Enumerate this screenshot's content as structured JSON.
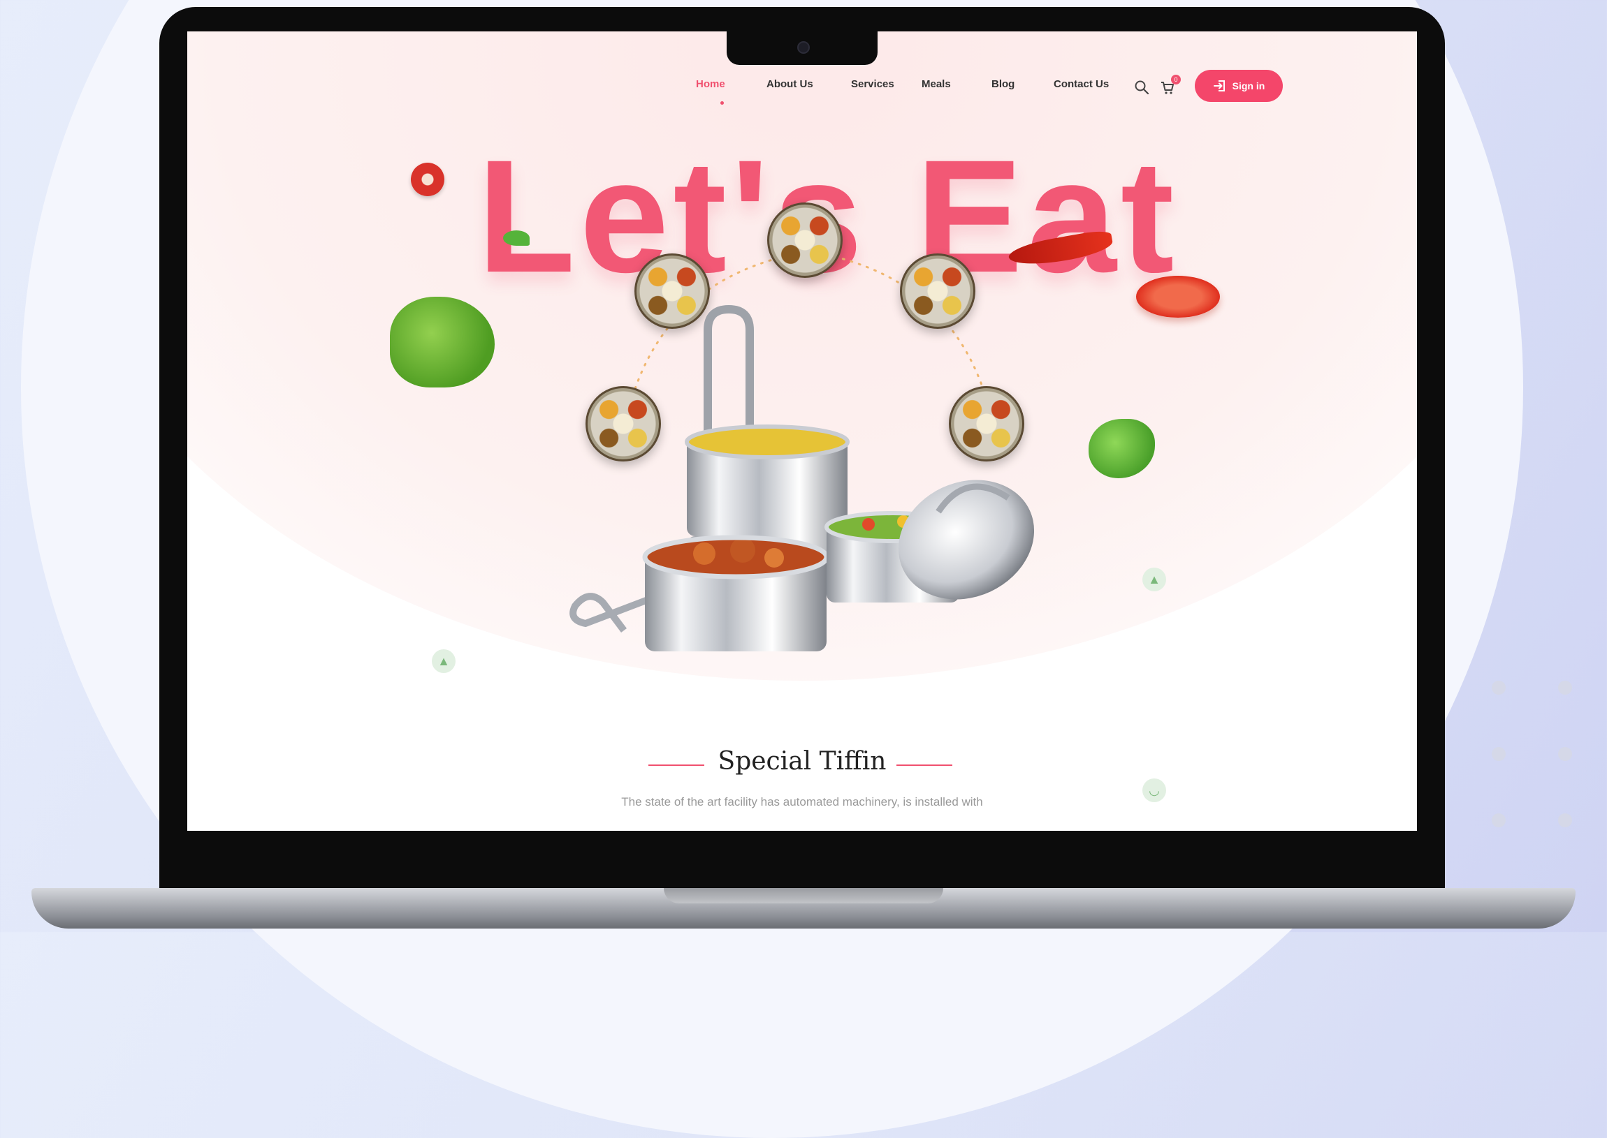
{
  "nav": {
    "items": [
      "Home",
      "About Us",
      "Services",
      "Meals",
      "Blog",
      "Contact Us"
    ],
    "active": "Home",
    "cart_count": "0",
    "signin_label": "Sign in"
  },
  "hero": {
    "title": "Let's Eat"
  },
  "section": {
    "title": "Special Tiffin",
    "subtitle": "The state of the art facility has automated machinery, is installed with"
  },
  "colors": {
    "accent": "#f0506e",
    "title": "#f25875"
  },
  "icons": [
    "search-icon",
    "cart-icon",
    "sign-in-icon"
  ]
}
